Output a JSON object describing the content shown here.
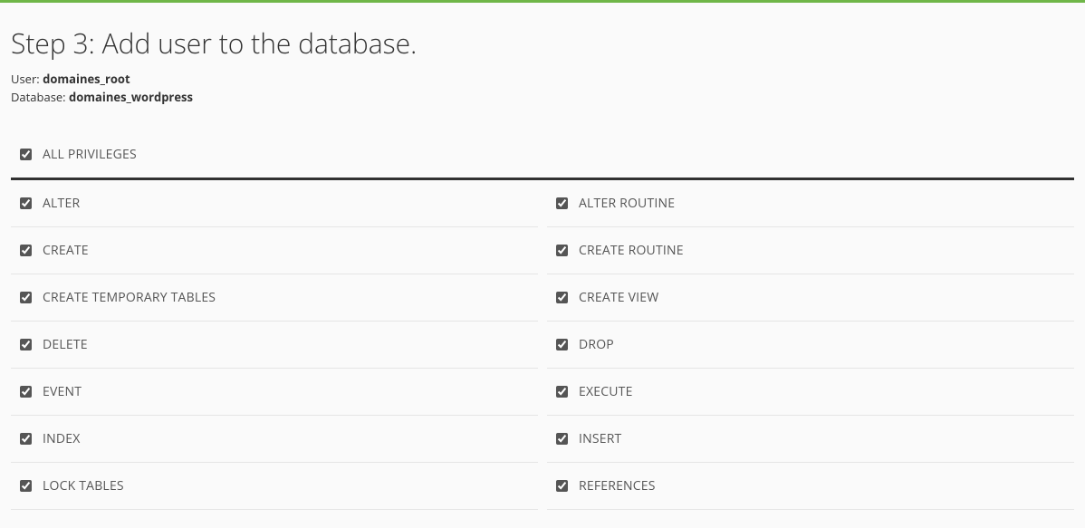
{
  "heading": "Step 3: Add user to the database.",
  "user_label": "User:",
  "user_value": "domaines_root",
  "db_label": "Database:",
  "db_value": "domaines_wordpress",
  "all_privs": {
    "label": "ALL PRIVILEGES",
    "checked": true
  },
  "left": [
    {
      "key": "alter",
      "label": "ALTER",
      "checked": true
    },
    {
      "key": "create",
      "label": "CREATE",
      "checked": true
    },
    {
      "key": "create-temp-tables",
      "label": "CREATE TEMPORARY TABLES",
      "checked": true
    },
    {
      "key": "delete",
      "label": "DELETE",
      "checked": true
    },
    {
      "key": "event",
      "label": "EVENT",
      "checked": true
    },
    {
      "key": "index",
      "label": "INDEX",
      "checked": true
    },
    {
      "key": "lock-tables",
      "label": "LOCK TABLES",
      "checked": true
    }
  ],
  "right": [
    {
      "key": "alter-routine",
      "label": "ALTER ROUTINE",
      "checked": true
    },
    {
      "key": "create-routine",
      "label": "CREATE ROUTINE",
      "checked": true
    },
    {
      "key": "create-view",
      "label": "CREATE VIEW",
      "checked": true
    },
    {
      "key": "drop",
      "label": "DROP",
      "checked": true
    },
    {
      "key": "execute",
      "label": "EXECUTE",
      "checked": true
    },
    {
      "key": "insert",
      "label": "INSERT",
      "checked": true
    },
    {
      "key": "references",
      "label": "REFERENCES",
      "checked": true
    }
  ]
}
